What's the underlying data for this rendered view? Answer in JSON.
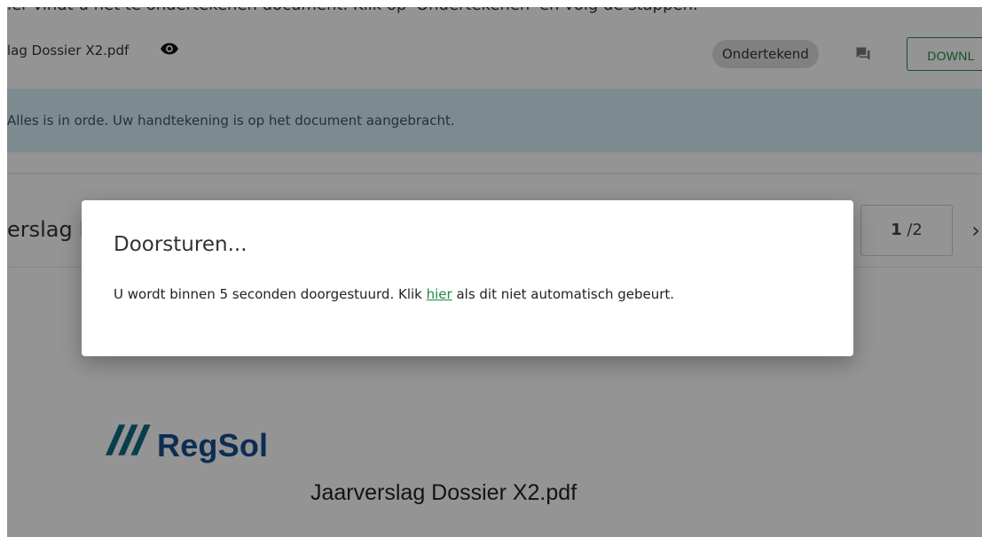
{
  "page": {
    "cutoff_instruction": "ler vindt u het te ondertekenen document. Klik op 'Ondertekenen' en volg de stappen.",
    "file_row": {
      "file_name": "lag Dossier X2.pdf",
      "view_icon": "eye-icon",
      "status_label": "Ondertekend",
      "comment_icon": "comment-icon",
      "download_label": "DOWNL"
    },
    "alert": {
      "message": "Alles is in orde. Uw handtekening is op het document aangebracht."
    },
    "preview": {
      "title": "erslag D",
      "page_current": "1",
      "page_total": "/2",
      "next_icon": "chevron-right-icon",
      "logo_text": "RegSol",
      "document_name": "Jaarverslag Dossier X2.pdf"
    }
  },
  "dialog": {
    "title": "Doorsturen...",
    "body_before": "U wordt binnen 5 seconden doorgestuurd. Klik ",
    "link_label": "hier",
    "body_after": " als dit niet automatisch gebeurt."
  },
  "colors": {
    "accent_green": "#1f8a46",
    "logo_blue": "#184e91",
    "alert_background": "#d7f0f8",
    "modal_overlay": "#000000"
  }
}
